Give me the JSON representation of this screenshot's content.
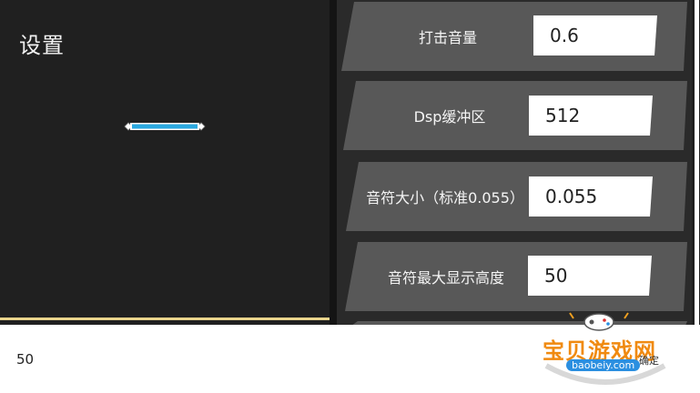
{
  "page": {
    "title": "设置"
  },
  "preview": {
    "note_color": "#29a8e0"
  },
  "settings": [
    {
      "label": "打击音量",
      "value": "0.6"
    },
    {
      "label": "Dsp缓冲区",
      "value": "512"
    },
    {
      "label": "音符大小（标准0.055）",
      "value": "0.055"
    },
    {
      "label": "音符最大显示高度",
      "value": "50"
    }
  ],
  "bottom": {
    "value": "50"
  },
  "watermark": {
    "brand": "宝贝游戏网",
    "url": "baobeiy.com",
    "peek_text": "确定"
  },
  "colors": {
    "left_bg": "#202020",
    "row_bg": "#585858",
    "accent_line": "#e9d48c",
    "watermark_orange": "#f08a10",
    "watermark_blue": "#2b8fe0"
  }
}
